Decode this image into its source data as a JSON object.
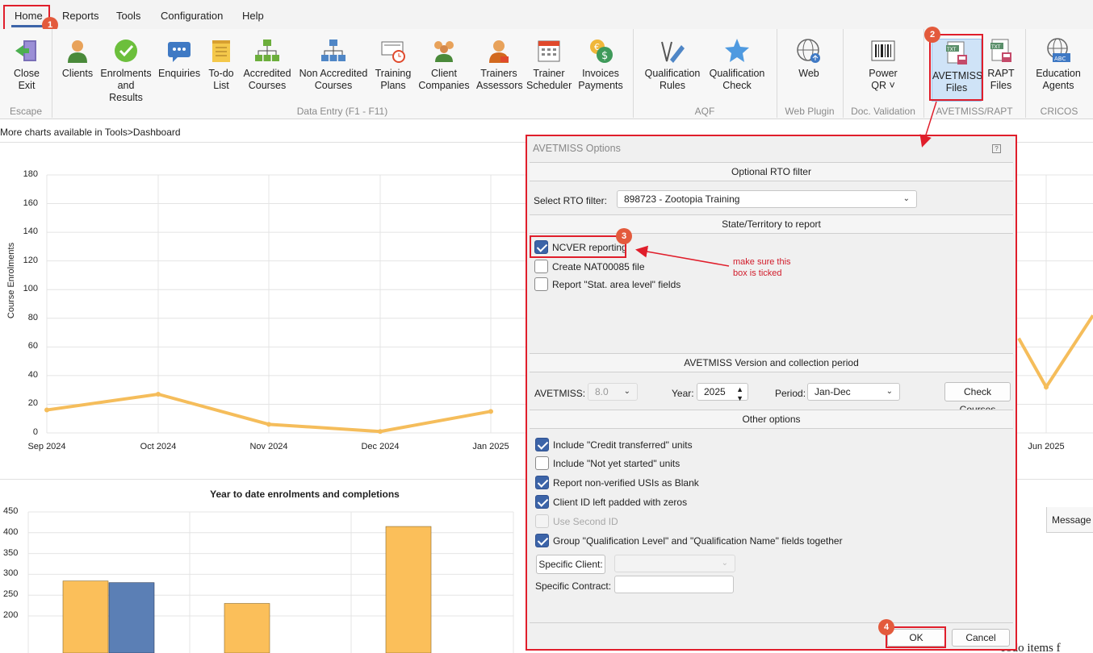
{
  "menubar": {
    "items": [
      "Home",
      "Reports",
      "Tools",
      "Configuration",
      "Help"
    ]
  },
  "ribbon": {
    "buttons": {
      "close_exit": "Close\nExit",
      "clients": "Clients",
      "enrolments": "Enrolments\nand Results",
      "enquiries": "Enquiries",
      "todo": "To-do\nList",
      "accredited": "Accredited\nCourses",
      "non_accredited": "Non Accredited\nCourses",
      "training_plans": "Training\nPlans",
      "client_companies": "Client\nCompanies",
      "trainers_assessors": "Trainers\nAssessors",
      "trainer_scheduler": "Trainer\nScheduler",
      "invoices": "Invoices\nPayments",
      "qual_rules": "Qualification\nRules",
      "qual_check": "Qualification\nCheck",
      "web": "Web",
      "power_qr": "Power\nQR ˅",
      "avetmiss_files": "AVETMISS\nFiles",
      "rapt_files": "RAPT\nFiles",
      "education_agents": "Education\nAgents"
    },
    "groups": {
      "escape": "Escape",
      "data_entry": "Data Entry (F1 - F11)",
      "aqf": "AQF",
      "web_plugin": "Web Plugin",
      "doc_validation": "Doc. Validation",
      "avetmiss_rapt": "AVETMISS/RAPT",
      "cricos": "CRICOS"
    }
  },
  "dashboard": {
    "hint": "More charts available in Tools>Dashboard",
    "line_chart_ylabel": "Course Enrolments",
    "bar_chart_title": "Year to date enrolments and completions",
    "message_header": "Message",
    "todo_fragment": "Todo items f"
  },
  "chart_data": [
    {
      "type": "line",
      "ylabel": "Course Enrolments",
      "ylim": [
        0,
        180
      ],
      "yticks": [
        "0",
        "20",
        "40",
        "60",
        "80",
        "100",
        "120",
        "140",
        "160",
        "180"
      ],
      "x": [
        "Sep 2024",
        "Oct 2024",
        "Nov 2024",
        "Dec 2024",
        "Jan 2025",
        "Jun 2025"
      ],
      "series": [
        {
          "values": [
            16,
            27,
            6,
            1,
            15,
            32
          ],
          "color": "#f5bd5b"
        }
      ],
      "grid": true
    },
    {
      "type": "bar",
      "title": "Year to date enrolments and completions",
      "ylim": [
        200,
        450
      ],
      "yticks": [
        "200",
        "250",
        "300",
        "350",
        "400",
        "450"
      ],
      "series": [
        {
          "values": [
            284,
            230,
            415
          ],
          "color": "#fbbf5a"
        },
        {
          "values": [
            280
          ],
          "color": "#5b7fb5"
        }
      ]
    }
  ],
  "dialog": {
    "title": "AVETMISS Options",
    "help_icon": "?",
    "sections": {
      "rto_filter": "Optional RTO filter",
      "state": "State/Territory to report",
      "version": "AVETMISS Version and collection period",
      "other": "Other options"
    },
    "rto": {
      "label": "Select RTO filter:",
      "value": "898723 - Zootopia Training"
    },
    "state_options": [
      {
        "label": "NCVER reporting",
        "checked": true
      },
      {
        "label": "Create NAT00085 file",
        "checked": false
      },
      {
        "label": "Report \"Stat. area level\" fields",
        "checked": false
      }
    ],
    "version": {
      "avetmiss_label": "AVETMISS:",
      "avetmiss_value": "8.0",
      "year_label": "Year:",
      "year_value": "2025",
      "period_label": "Period:",
      "period_value": "Jan-Dec",
      "check_courses": "Check Courses"
    },
    "other_options": [
      {
        "label": "Include \"Credit transferred\" units",
        "checked": true
      },
      {
        "label": "Include \"Not yet started\" units",
        "checked": false
      },
      {
        "label": "Report non-verified USIs as Blank",
        "checked": true
      },
      {
        "label": "Client ID left padded with zeros",
        "checked": true
      },
      {
        "label": "Use Second ID",
        "checked": false,
        "disabled": true
      },
      {
        "label": "Group \"Qualification Level\" and \"Qualification Name\" fields together",
        "checked": true
      }
    ],
    "specific_client_button": "Specific Client:",
    "specific_contract_label": "Specific Contract:",
    "ok": "OK",
    "cancel": "Cancel"
  },
  "annotations": {
    "note": "make sure this\nbox is ticked",
    "badges": [
      "1",
      "2",
      "3",
      "4"
    ]
  },
  "colors": {
    "accent_red": "#e01e2b",
    "badge": "#e35a3c",
    "line": "#f5bd5b",
    "bar_orange": "#fbbf5a",
    "bar_blue": "#5b7fb5",
    "checkbox": "#3c64a8"
  }
}
